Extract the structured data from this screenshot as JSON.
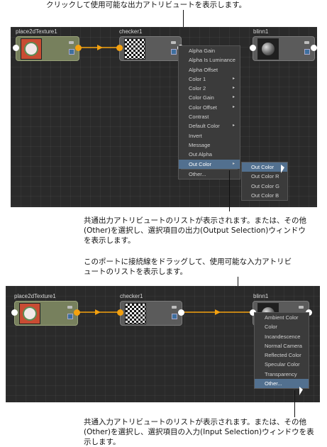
{
  "captions": {
    "top": "クリックして使用可能な出力アトリビュートを表示します。",
    "middle": "共通出力アトリビュートのリストが表示されます。または、その他(Other)を選択し、選択項目の出力(Output Selection)ウィンドウを表示します。",
    "drag": "このポートに接続線をドラッグして、使用可能な入力アトリビュートのリストを表示します。",
    "bottom": "共通入力アトリビュートのリストが表示されます。または、その他(Other)を選択し、選択項目の入力(Input Selection)ウィンドウを表示します。"
  },
  "top_panel": {
    "nodes": [
      {
        "label": "place2dTexture1",
        "icon": "place2d-texture-icon"
      },
      {
        "label": "checker1",
        "icon": "checker-texture-icon"
      },
      {
        "label": "blinn1",
        "icon": "blinn-sphere-icon"
      }
    ],
    "output_menu": [
      {
        "label": "Alpha Gain",
        "submenu": false
      },
      {
        "label": "Alpha Is Luminance",
        "submenu": false
      },
      {
        "label": "Alpha Offset",
        "submenu": false
      },
      {
        "label": "Color 1",
        "submenu": true
      },
      {
        "label": "Color 2",
        "submenu": true
      },
      {
        "label": "Color Gain",
        "submenu": true
      },
      {
        "label": "Color Offset",
        "submenu": true
      },
      {
        "label": "Contrast",
        "submenu": false
      },
      {
        "label": "Default Color",
        "submenu": true
      },
      {
        "label": "Invert",
        "submenu": false
      },
      {
        "label": "Message",
        "submenu": false
      },
      {
        "label": "Out Alpha",
        "submenu": false
      },
      {
        "label": "Out Color",
        "submenu": true,
        "highlighted": true
      },
      {
        "label": "Other...",
        "submenu": false
      }
    ],
    "out_color_submenu": [
      {
        "label": "Out Color",
        "highlighted": true
      },
      {
        "label": "Out Color R"
      },
      {
        "label": "Out Color G"
      },
      {
        "label": "Out Color B"
      }
    ]
  },
  "bottom_panel": {
    "nodes": [
      {
        "label": "place2dTexture1",
        "icon": "place2d-texture-icon"
      },
      {
        "label": "checker1",
        "icon": "checker-texture-icon"
      },
      {
        "label": "blinn1",
        "icon": "blinn-sphere-icon"
      }
    ],
    "input_menu": [
      {
        "label": "Ambient Color"
      },
      {
        "label": "Color"
      },
      {
        "label": "Incandescence"
      },
      {
        "label": "Normal Camera"
      },
      {
        "label": "Reflected Color"
      },
      {
        "label": "Specular Color"
      },
      {
        "label": "Transparency"
      },
      {
        "label": "Other...",
        "highlighted": true
      }
    ]
  },
  "colors": {
    "canvas": "#2a2a2a",
    "connection": "#f4a10f",
    "menu_bg": "#3b3b3b",
    "highlight": "#52708f"
  },
  "arrow_glyph": "▸"
}
